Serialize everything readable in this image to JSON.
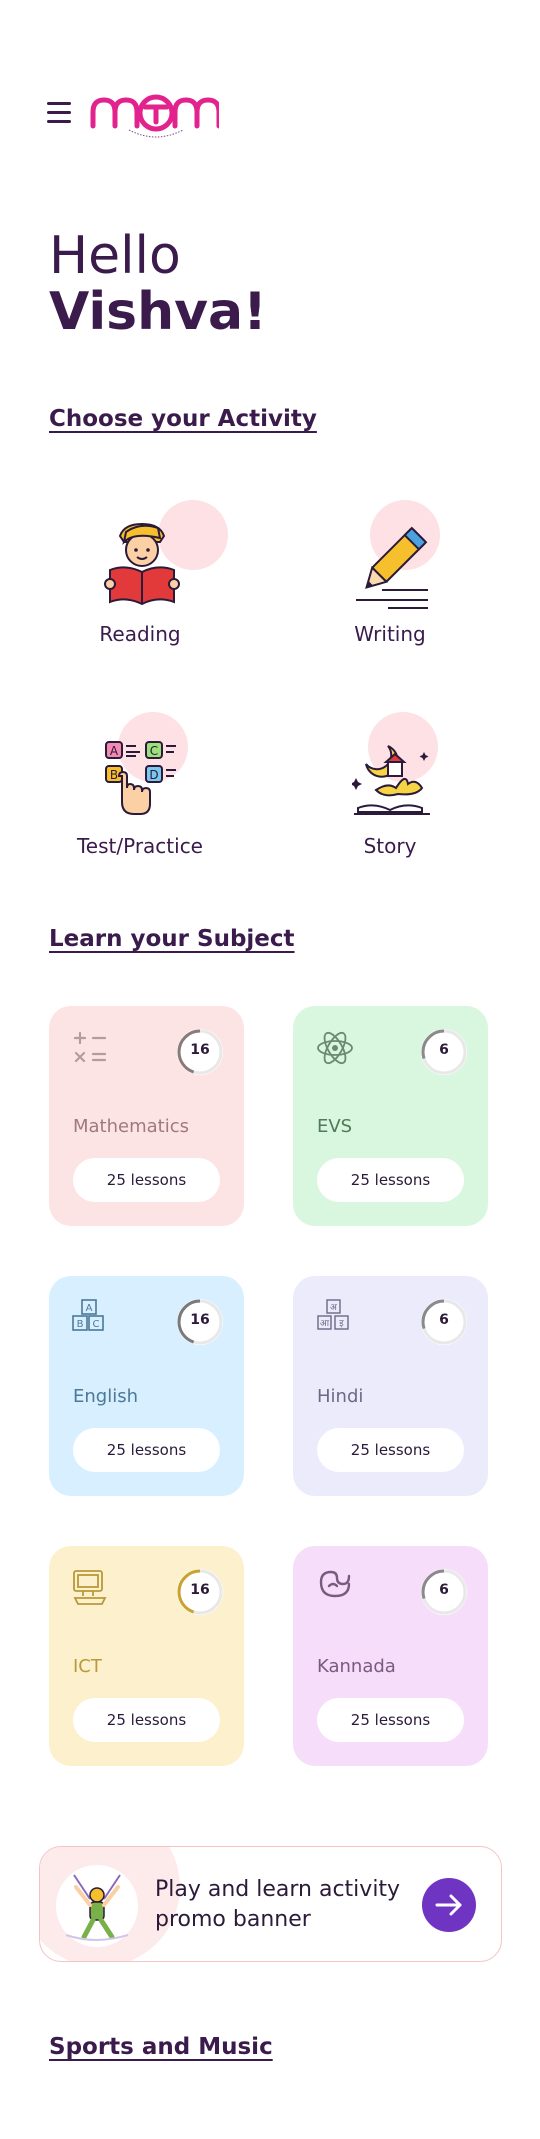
{
  "greeting": {
    "hello": "Hello",
    "name": "Vishva!"
  },
  "logo": {
    "text": "MTM"
  },
  "sections": {
    "activity": "Choose your Activity",
    "subject": "Learn your Subject",
    "sports": "Sports and Music"
  },
  "activities": [
    {
      "label": "Reading",
      "icon": "reading-boy-icon"
    },
    {
      "label": "Writing",
      "icon": "pencil-icon"
    },
    {
      "label": "Test/Practice",
      "icon": "abcd-blocks-icon"
    },
    {
      "label": "Story",
      "icon": "story-book-icon"
    }
  ],
  "subjects": [
    {
      "name": "Mathematics",
      "count": "16",
      "lessons": "25 lessons",
      "progress": 0.45,
      "bg": "#fde4e4",
      "text_color": "#a07a7a",
      "icon": "math-symbols-icon"
    },
    {
      "name": "EVS",
      "count": "6",
      "lessons": "25 lessons",
      "progress": 0.3,
      "bg": "#d9f6df",
      "text_color": "#4f7a55",
      "icon": "atom-icon"
    },
    {
      "name": "English",
      "count": "16",
      "lessons": "25 lessons",
      "progress": 0.45,
      "bg": "#d7effe",
      "text_color": "#4d7898",
      "icon": "abc-blocks-icon"
    },
    {
      "name": "Hindi",
      "count": "6",
      "lessons": "25 lessons",
      "progress": 0.3,
      "bg": "#ecebfb",
      "text_color": "#6a6a86",
      "icon": "hindi-letters-icon"
    },
    {
      "name": "ICT",
      "count": "16",
      "lessons": "25 lessons",
      "progress": 0.45,
      "bg": "#fdf0cd",
      "text_color": "#b89a3a",
      "icon": "computer-icon"
    },
    {
      "name": "Kannada",
      "count": "6",
      "lessons": "25 lessons",
      "progress": 0.3,
      "bg": "#f6defa",
      "text_color": "#7a5a82",
      "icon": "kannada-letter-icon"
    }
  ],
  "banner": {
    "text": "Play and learn activity promo banner",
    "icon": "arrow-right-icon"
  },
  "colors": {
    "primary": "#3a1b4c",
    "accent": "#6f35c2",
    "pink": "#e2238d",
    "blob": "#fde1e4"
  }
}
